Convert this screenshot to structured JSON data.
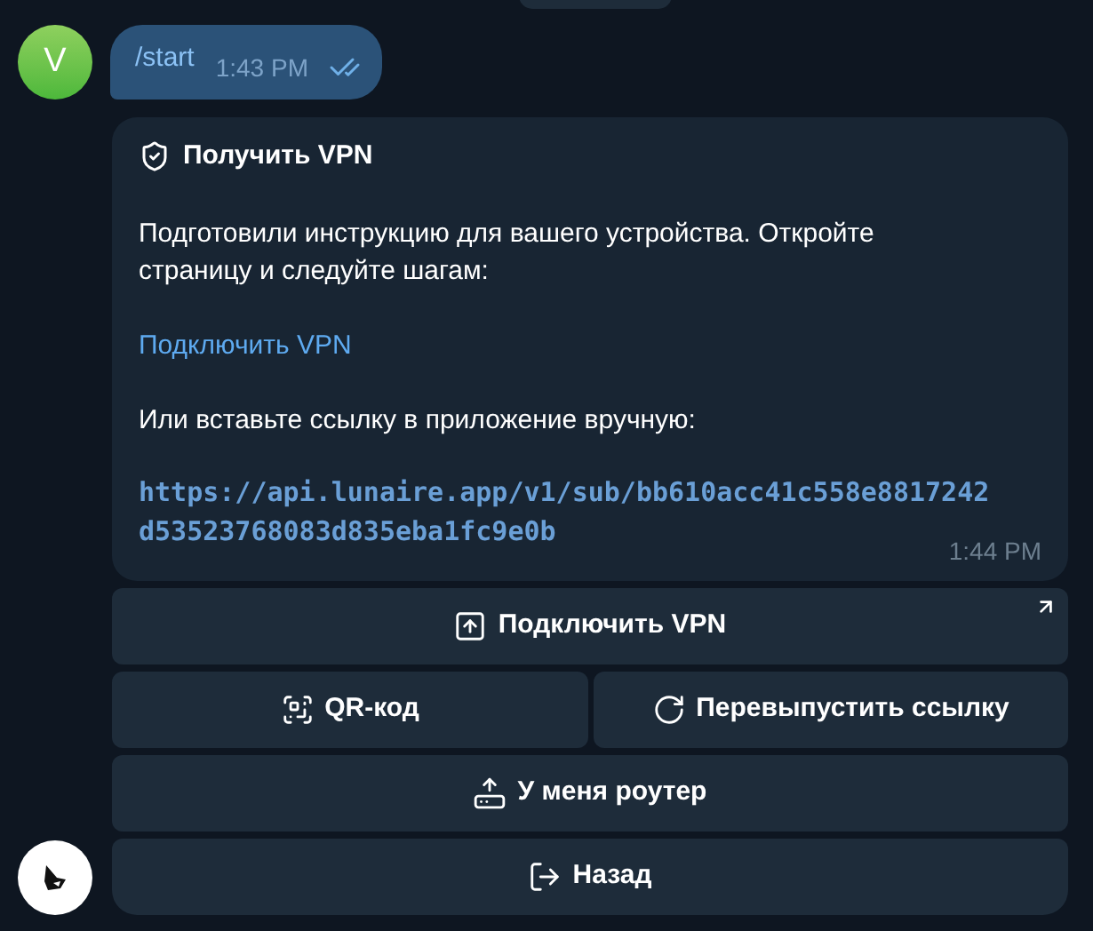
{
  "user_message": {
    "avatar_letter": "V",
    "text": "/start",
    "time": "1:43 PM",
    "read": true
  },
  "bot_message": {
    "title": "Получить VPN",
    "paragraphs": [
      {
        "kind": "text",
        "text": "Подготовили инструкцию для вашего устройства. Откройте страницу и следуйте шагам:"
      },
      {
        "kind": "link",
        "text": "Подключить VPN"
      },
      {
        "kind": "text",
        "text": "Или вставьте ссылку в приложение вручную:"
      },
      {
        "kind": "code",
        "text": "https://api.lunaire.app/v1/sub/bb610acc41c558e8817242d53523768083d835eba1fc9e0b"
      }
    ],
    "time": "1:44 PM"
  },
  "keyboard": [
    [
      {
        "label": "Подключить VPN",
        "kind": "connect",
        "external": true
      }
    ],
    [
      {
        "label": "QR-код",
        "kind": "qr",
        "external": false
      },
      {
        "label": "Перевыпустить ссылку",
        "kind": "reissue",
        "external": false
      }
    ],
    [
      {
        "label": "У меня роутер",
        "kind": "router",
        "external": false
      }
    ],
    [
      {
        "label": "Назад",
        "kind": "back",
        "external": false
      }
    ]
  ]
}
